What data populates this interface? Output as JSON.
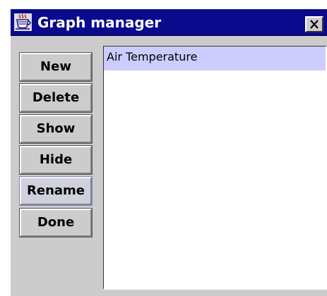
{
  "window": {
    "title": "Graph manager",
    "icon": "java-coffee-cup-icon",
    "close_icon": "close-x-icon"
  },
  "buttons": [
    {
      "label": "New",
      "name": "new-button"
    },
    {
      "label": "Delete",
      "name": "delete-button"
    },
    {
      "label": "Show",
      "name": "show-button"
    },
    {
      "label": "Hide",
      "name": "hide-button"
    },
    {
      "label": "Rename",
      "name": "rename-button",
      "focused": true
    },
    {
      "label": "Done",
      "name": "done-button"
    }
  ],
  "graph_list": {
    "items": [
      {
        "label": "Air Temperature",
        "selected": true
      }
    ]
  },
  "colors": {
    "titlebar": "#0a0a8c",
    "window_bg": "#cccccc",
    "selection": "#ccccff"
  }
}
